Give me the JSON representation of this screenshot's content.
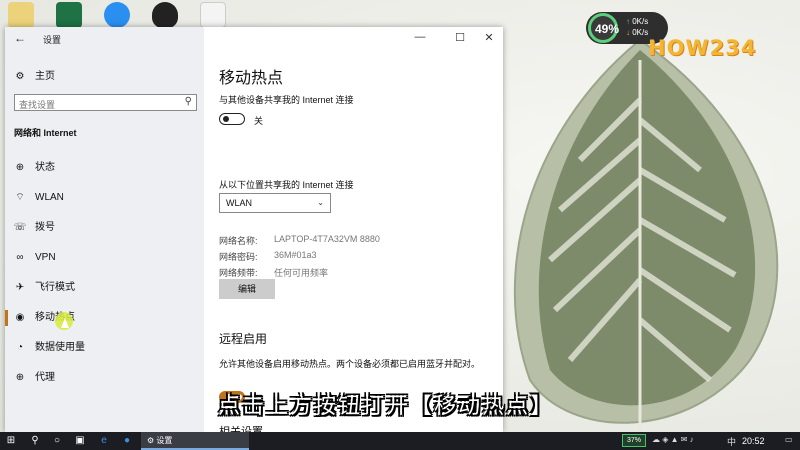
{
  "window": {
    "title": "设置",
    "back_icon": "←",
    "minimize": "—",
    "maximize": "☐",
    "close": "✕"
  },
  "sidebar": {
    "home_label": "主页",
    "search_placeholder": "查找设置",
    "section_title": "网络和 Internet",
    "items": [
      {
        "label": "状态",
        "icon": "globe-icon"
      },
      {
        "label": "WLAN",
        "icon": "wifi-icon"
      },
      {
        "label": "拨号",
        "icon": "phone-icon"
      },
      {
        "label": "VPN",
        "icon": "vpn-icon"
      },
      {
        "label": "飞行模式",
        "icon": "airplane-icon"
      },
      {
        "label": "移动热点",
        "icon": "hotspot-icon",
        "active": true
      },
      {
        "label": "数据使用量",
        "icon": "data-usage-icon"
      },
      {
        "label": "代理",
        "icon": "proxy-icon"
      }
    ]
  },
  "main": {
    "title": "移动热点",
    "share_label": "与其他设备共享我的 Internet 连接",
    "share_toggle_state": "关",
    "share_from_label": "从以下位置共享我的 Internet 连接",
    "share_from_value": "WLAN",
    "details": [
      {
        "key": "网络名称:",
        "value": "LAPTOP-4T7A32VM 8880"
      },
      {
        "key": "网络密码:",
        "value": "36M#01a3"
      },
      {
        "key": "网络频带:",
        "value": "任何可用频率"
      }
    ],
    "edit_button": "编辑",
    "remote_title": "远程启用",
    "remote_desc": "允许其他设备启用移动热点。两个设备必须都已启用蓝牙并配对。",
    "remote_toggle_state": "开",
    "next_section_partial": "相关设置"
  },
  "subtitle": "点击上方按钮打开【移动热点】",
  "widget": {
    "percent": "49%",
    "up_speed": "0K/s",
    "down_speed": "0K/s",
    "brand": "HOW234"
  },
  "taskbar": {
    "app_label": "设置",
    "battery": "37%",
    "ime": "中",
    "time": "20:52"
  },
  "colors": {
    "accent": "#c0731a",
    "taskbar": "#1b1d22"
  }
}
